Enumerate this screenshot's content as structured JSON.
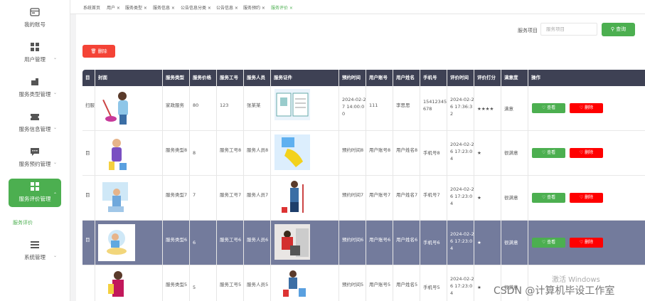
{
  "sidebar": {
    "items": [
      {
        "label": "我的账号",
        "icon": "account-icon"
      },
      {
        "label": "用户管理",
        "icon": "grid-icon"
      },
      {
        "label": "服务类型管理",
        "icon": "tag-icon"
      },
      {
        "label": "服务信息管理",
        "icon": "ticket-icon"
      },
      {
        "label": "服务预约管理",
        "icon": "chat-icon"
      },
      {
        "label": "服务评价管理",
        "icon": "grid-icon"
      },
      {
        "label": "系统管理",
        "icon": "list-icon"
      }
    ],
    "sub_item": "服务评价"
  },
  "tabs": [
    "系统首页",
    "用户 ×",
    "服务类型 ×",
    "服务信息 ×",
    "公告信息分类 ×",
    "公告信息 ×",
    "服务预约 ×",
    "服务评价 ×"
  ],
  "search": {
    "label": "服务项目",
    "placeholder": "服务项目",
    "button": "查询"
  },
  "delete_button": "删除",
  "table": {
    "headers": [
      "目",
      "封面",
      "服务类型",
      "服务价格",
      "服务工号",
      "服务人员",
      "服务证件",
      "预约时间",
      "用户账号",
      "用户姓名",
      "手机号",
      "评价时间",
      "评价打分",
      "满意度",
      "操作"
    ],
    "rows": [
      {
        "item": "扫服",
        "type": "家政服务",
        "price": "80",
        "worker_no": "123",
        "worker": "张某某",
        "time": "2024-02-27 14:00:00",
        "account": "111",
        "name": "李思思",
        "phone": "15412345678",
        "eval_time": "2024-02-26 17:36:32",
        "score": "★★★★",
        "satisfaction": "满意"
      },
      {
        "item": "目",
        "type": "服务类型8",
        "price": "8",
        "worker_no": "服务工号8",
        "worker": "服务人员8",
        "time": "预约时间8",
        "account": "用户账号8",
        "name": "用户姓名8",
        "phone": "手机号8",
        "eval_time": "2024-02-26 17:23:04",
        "score": "★",
        "satisfaction": "很满意"
      },
      {
        "item": "目",
        "type": "服务类型7",
        "price": "7",
        "worker_no": "服务工号7",
        "worker": "服务人员7",
        "time": "预约时间7",
        "account": "用户账号7",
        "name": "用户姓名7",
        "phone": "手机号7",
        "eval_time": "2024-02-26 17:23:04",
        "score": "★",
        "satisfaction": "很满意"
      },
      {
        "item": "目",
        "type": "服务类型6",
        "price": "6",
        "worker_no": "服务工号6",
        "worker": "服务人员6",
        "time": "预约时间6",
        "account": "用户账号6",
        "name": "用户姓名6",
        "phone": "手机号6",
        "eval_time": "2024-02-26 17:23:04",
        "score": "★",
        "satisfaction": "很满意"
      },
      {
        "item": "目",
        "type": "服务类型5",
        "price": "5",
        "worker_no": "服务工号5",
        "worker": "服务人员5",
        "time": "预约时间5",
        "account": "用户账号5",
        "name": "用户姓名5",
        "phone": "手机号5",
        "eval_time": "2024-02-26 17:23:04",
        "score": "★",
        "satisfaction": "很满意"
      }
    ],
    "view_label": "查看",
    "delete_label": "删除"
  },
  "watermark": "激活 Windows",
  "csdn_mark": "CSDN @计算机毕设工作室",
  "colors": {
    "accent": "#4caf50",
    "danger": "#f44336",
    "header": "#3e4154",
    "highlight_row": "#737b9c"
  }
}
